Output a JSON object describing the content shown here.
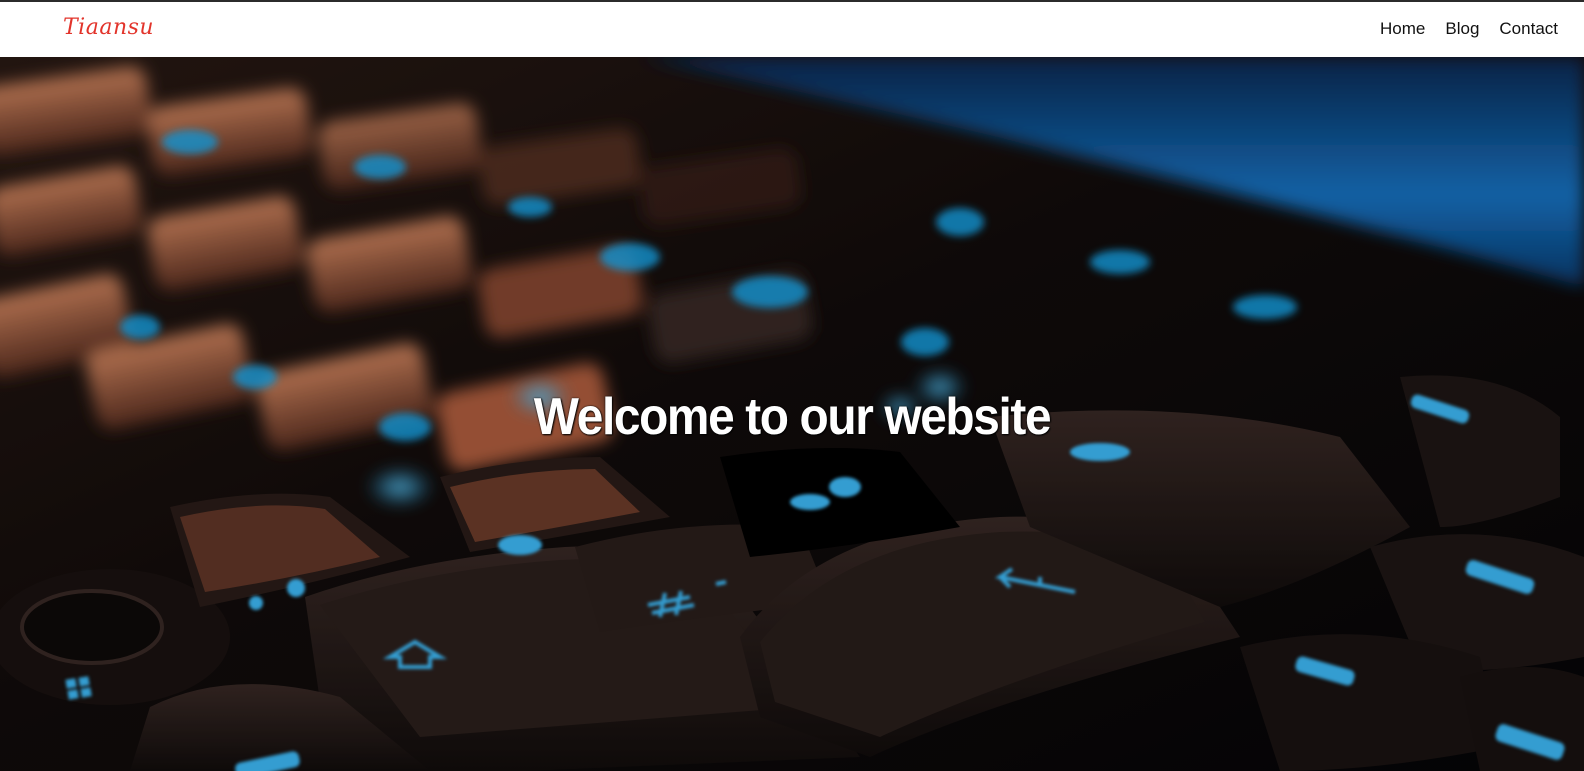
{
  "site": {
    "logo": "Tiaansu"
  },
  "nav": {
    "links": [
      {
        "label": "Home"
      },
      {
        "label": "Blog"
      },
      {
        "label": "Contact"
      }
    ]
  },
  "hero": {
    "title": "Welcome to our website",
    "image": "backlit-keyboard-photo"
  },
  "colors": {
    "logo": "#e2342b",
    "accent_glow": "#19b4ff",
    "key_warm": "#b5613f"
  }
}
